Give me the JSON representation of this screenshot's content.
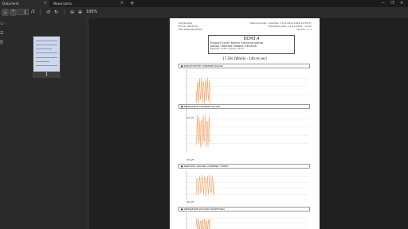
{
  "tabs": [
    {
      "label": "Dokument"
    },
    {
      "label": "Nowa karta"
    }
  ],
  "toolbar": {
    "current_page": "1",
    "page_count": "/1",
    "zoom": "100%"
  },
  "sidebar": {
    "thumbnail_number": "1"
  },
  "document": {
    "header_left": [
      "Użytkownik",
      "Firma: ODCE.8/1",
      "Plik: PRG/ARS/ZOCE"
    ],
    "header_right": [
      "Data wydruku: czwartek, 15 grudnia 2022 22:52:07",
      "Przedział czasu: 11-12-2022 - 12:00",
      "Strona: 1 / 1"
    ],
    "title": "DCM3.4",
    "subtitle_lines": [
      "Eksport Excel: Koniec ciśnienia paliwa",
      "paliwa, Wartość zadana ciśnienia"
    ],
    "file_line": "Nagłówek: DCM3.4_Wykres_ciśnień",
    "period": "17.29s (Wtorki - 14h:m:sec)",
    "sections": [
      {
        "label": "● RZECZYWISTE CIŚNIENIE PALIWA",
        "note": "DTA ZF"
      },
      {
        "label": "● ZMIERZONE CIŚNIENIE PALIWA",
        "note": "DTA ZF"
      },
      {
        "label": "● WARTOŚĆ ZADANA CIŚNIENIA TURBO",
        "note": "DTA ZF"
      },
      {
        "label": "● ZMIERZONE WYDATKI POWIETRZA",
        "note": ""
      }
    ]
  },
  "colors": {
    "accent": "#f0a060",
    "page": "#ffffff",
    "app_bg": "#202020"
  }
}
